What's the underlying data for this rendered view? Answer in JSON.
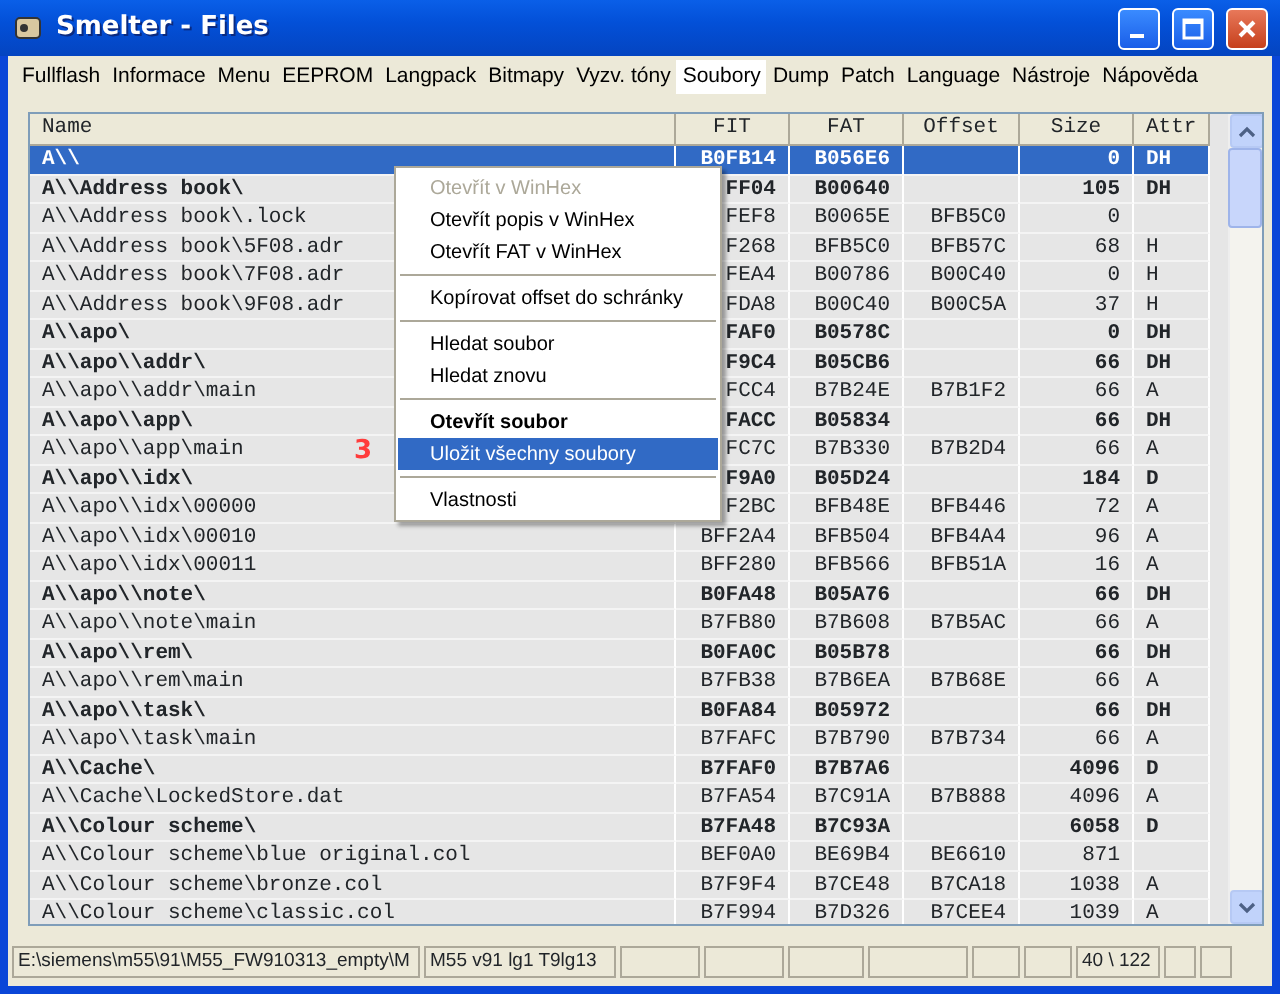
{
  "window": {
    "title": "Smelter - Files"
  },
  "tabs": [
    {
      "label": "Fullflash",
      "selected": false
    },
    {
      "label": "Informace",
      "selected": false
    },
    {
      "label": "Menu",
      "selected": false
    },
    {
      "label": "EEPROM",
      "selected": false
    },
    {
      "label": "Langpack",
      "selected": false
    },
    {
      "label": "Bitmapy",
      "selected": false
    },
    {
      "label": "Vyzv. tóny",
      "selected": false
    },
    {
      "label": "Soubory",
      "selected": true
    },
    {
      "label": "Dump",
      "selected": false
    },
    {
      "label": "Patch",
      "selected": false
    },
    {
      "label": "Language",
      "selected": false
    },
    {
      "label": "Nástroje",
      "selected": false
    },
    {
      "label": "Nápověda",
      "selected": false
    }
  ],
  "table": {
    "columns": [
      "Name",
      "FIT",
      "FAT",
      "Offset",
      "Size",
      "Attr"
    ],
    "rows": [
      {
        "kind": "folder",
        "selected": true,
        "cells": [
          "A\\\\",
          "B0FB14",
          "B056E6",
          "",
          "0",
          "DH"
        ]
      },
      {
        "kind": "folder",
        "selected": false,
        "cells": [
          "A\\\\Address book\\",
          "FF04",
          "B00640",
          "",
          "105",
          "DH"
        ]
      },
      {
        "kind": "file",
        "selected": false,
        "cells": [
          "A\\\\Address book\\.lock",
          "FEF8",
          "B0065E",
          "BFB5C0",
          "0",
          ""
        ]
      },
      {
        "kind": "file",
        "selected": false,
        "cells": [
          "A\\\\Address book\\5F08.adr",
          "F268",
          "BFB5C0",
          "BFB57C",
          "68",
          "H"
        ]
      },
      {
        "kind": "file",
        "selected": false,
        "cells": [
          "A\\\\Address book\\7F08.adr",
          "FEA4",
          "B00786",
          "B00C40",
          "0",
          "H"
        ]
      },
      {
        "kind": "file",
        "selected": false,
        "cells": [
          "A\\\\Address book\\9F08.adr",
          "FDA8",
          "B00C40",
          "B00C5A",
          "37",
          "H"
        ]
      },
      {
        "kind": "folder",
        "selected": false,
        "cells": [
          "A\\\\apo\\",
          "FAF0",
          "B0578C",
          "",
          "0",
          "DH"
        ]
      },
      {
        "kind": "folder",
        "selected": false,
        "cells": [
          "A\\\\apo\\\\addr\\",
          "F9C4",
          "B05CB6",
          "",
          "66",
          "DH"
        ]
      },
      {
        "kind": "file",
        "selected": false,
        "cells": [
          "A\\\\apo\\\\addr\\main",
          "FCC4",
          "B7B24E",
          "B7B1F2",
          "66",
          "A"
        ]
      },
      {
        "kind": "folder",
        "selected": false,
        "cells": [
          "A\\\\apo\\\\app\\",
          "FACC",
          "B05834",
          "",
          "66",
          "DH"
        ]
      },
      {
        "kind": "file",
        "selected": false,
        "cells": [
          "A\\\\apo\\\\app\\main",
          "FC7C",
          "B7B330",
          "B7B2D4",
          "66",
          "A"
        ]
      },
      {
        "kind": "folder",
        "selected": false,
        "cells": [
          "A\\\\apo\\\\idx\\",
          "F9A0",
          "B05D24",
          "",
          "184",
          "D"
        ]
      },
      {
        "kind": "file",
        "selected": false,
        "cells": [
          "A\\\\apo\\\\idx\\00000",
          "F2BC",
          "BFB48E",
          "BFB446",
          "72",
          "A"
        ]
      },
      {
        "kind": "file",
        "selected": false,
        "cells": [
          "A\\\\apo\\\\idx\\00010",
          "BFF2A4",
          "BFB504",
          "BFB4A4",
          "96",
          "A"
        ]
      },
      {
        "kind": "file",
        "selected": false,
        "cells": [
          "A\\\\apo\\\\idx\\00011",
          "BFF280",
          "BFB566",
          "BFB51A",
          "16",
          "A"
        ]
      },
      {
        "kind": "folder",
        "selected": false,
        "cells": [
          "A\\\\apo\\\\note\\",
          "B0FA48",
          "B05A76",
          "",
          "66",
          "DH"
        ]
      },
      {
        "kind": "file",
        "selected": false,
        "cells": [
          "A\\\\apo\\\\note\\main",
          "B7FB80",
          "B7B608",
          "B7B5AC",
          "66",
          "A"
        ]
      },
      {
        "kind": "folder",
        "selected": false,
        "cells": [
          "A\\\\apo\\\\rem\\",
          "B0FA0C",
          "B05B78",
          "",
          "66",
          "DH"
        ]
      },
      {
        "kind": "file",
        "selected": false,
        "cells": [
          "A\\\\apo\\\\rem\\main",
          "B7FB38",
          "B7B6EA",
          "B7B68E",
          "66",
          "A"
        ]
      },
      {
        "kind": "folder",
        "selected": false,
        "cells": [
          "A\\\\apo\\\\task\\",
          "B0FA84",
          "B05972",
          "",
          "66",
          "DH"
        ]
      },
      {
        "kind": "file",
        "selected": false,
        "cells": [
          "A\\\\apo\\\\task\\main",
          "B7FAFC",
          "B7B790",
          "B7B734",
          "66",
          "A"
        ]
      },
      {
        "kind": "folder",
        "selected": false,
        "cells": [
          "A\\\\Cache\\",
          "B7FAF0",
          "B7B7A6",
          "",
          "4096",
          "D"
        ]
      },
      {
        "kind": "file",
        "selected": false,
        "cells": [
          "A\\\\Cache\\LockedStore.dat",
          "B7FA54",
          "B7C91A",
          "B7B888",
          "4096",
          "A"
        ]
      },
      {
        "kind": "folder",
        "selected": false,
        "cells": [
          "A\\\\Colour scheme\\",
          "B7FA48",
          "B7C93A",
          "",
          "6058",
          "D"
        ]
      },
      {
        "kind": "file",
        "selected": false,
        "cells": [
          "A\\\\Colour scheme\\blue original.col",
          "BEF0A0",
          "BE69B4",
          "BE6610",
          "871",
          ""
        ]
      },
      {
        "kind": "file",
        "selected": false,
        "cells": [
          "A\\\\Colour scheme\\bronze.col",
          "B7F9F4",
          "B7CE48",
          "B7CA18",
          "1038",
          "A"
        ]
      },
      {
        "kind": "file",
        "selected": false,
        "cells": [
          "A\\\\Colour scheme\\classic.col",
          "B7F994",
          "B7D326",
          "B7CEE4",
          "1039",
          "A"
        ]
      }
    ]
  },
  "context_menu": {
    "items": [
      {
        "kind": "item",
        "label": "Otevřít v WinHex",
        "disabled": true,
        "bold": false,
        "selected": false
      },
      {
        "kind": "item",
        "label": "Otevřít popis v WinHex",
        "disabled": false,
        "bold": false,
        "selected": false
      },
      {
        "kind": "item",
        "label": "Otevřít FAT v WinHex",
        "disabled": false,
        "bold": false,
        "selected": false
      },
      {
        "kind": "separator"
      },
      {
        "kind": "item",
        "label": "Kopírovat offset do schránky",
        "disabled": false,
        "bold": false,
        "selected": false
      },
      {
        "kind": "separator"
      },
      {
        "kind": "item",
        "label": "Hledat soubor",
        "disabled": false,
        "bold": false,
        "selected": false
      },
      {
        "kind": "item",
        "label": "Hledat znovu",
        "disabled": false,
        "bold": false,
        "selected": false
      },
      {
        "kind": "separator"
      },
      {
        "kind": "item",
        "label": "Otevřít soubor",
        "disabled": false,
        "bold": true,
        "selected": false
      },
      {
        "kind": "item",
        "label": "Uložit všechny soubory",
        "disabled": false,
        "bold": false,
        "selected": true
      },
      {
        "kind": "separator"
      },
      {
        "kind": "item",
        "label": "Vlastnosti",
        "disabled": false,
        "bold": false,
        "selected": false
      }
    ]
  },
  "annotation": "3",
  "status_bar": [
    "E:\\siemens\\m55\\91\\M55_FW910313_empty\\M",
    "M55 v91 lg1 T9lg13",
    "40 \\ 122"
  ]
}
